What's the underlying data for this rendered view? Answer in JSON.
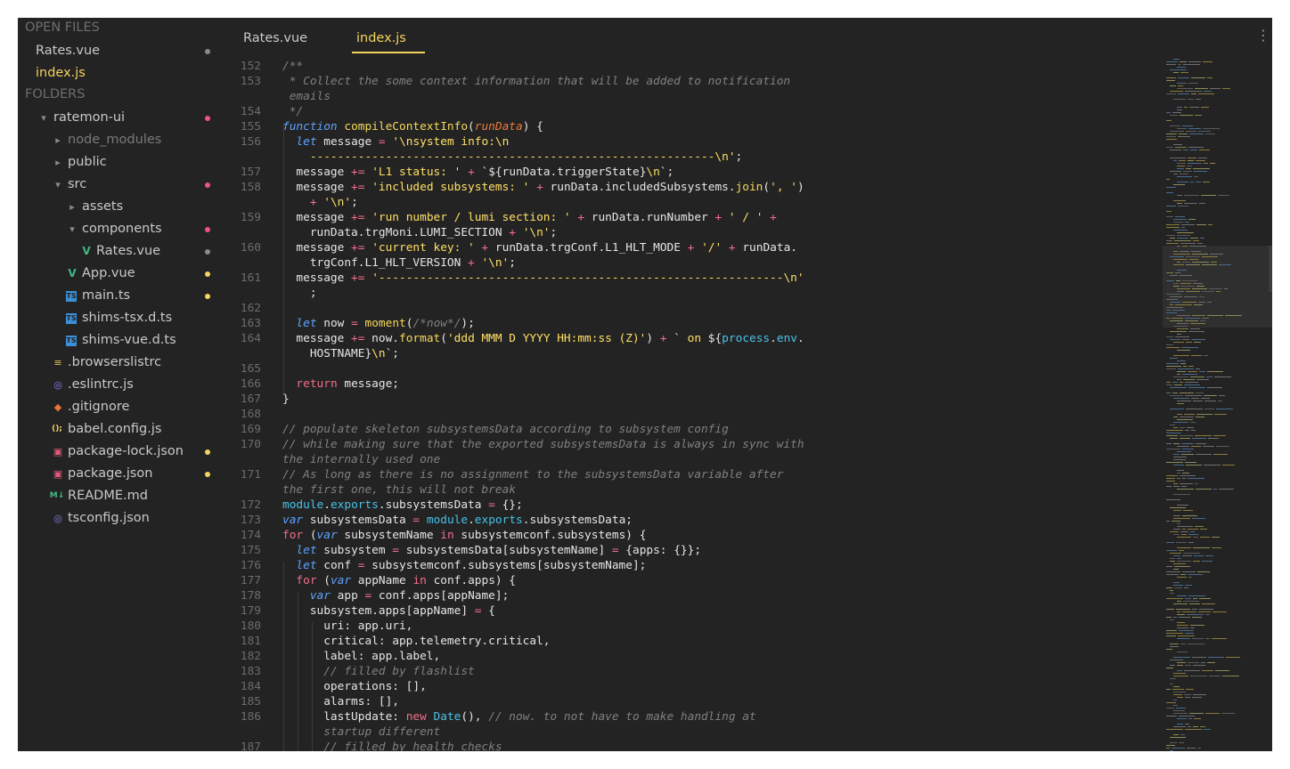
{
  "sidebar": {
    "open_files_label": "OPEN FILES",
    "folders_label": "FOLDERS",
    "open_files": [
      {
        "label": "Rates.vue",
        "active": false,
        "dot": "#8a8a8a"
      },
      {
        "label": "index.js",
        "active": true,
        "dot": ""
      }
    ],
    "tree": [
      {
        "label": "ratemon-ui",
        "indent": 0,
        "icon": "chevron-down-icon",
        "glyph": "▾",
        "icon_color": "#8a8a8a",
        "dot": "#f0508c",
        "muted": false
      },
      {
        "label": "node_modules",
        "indent": 1,
        "icon": "chevron-right-icon",
        "glyph": "▸",
        "icon_color": "#8a8a8a",
        "dot": "",
        "muted": true
      },
      {
        "label": "public",
        "indent": 1,
        "icon": "chevron-right-icon",
        "glyph": "▸",
        "icon_color": "#8a8a8a",
        "dot": "",
        "muted": false
      },
      {
        "label": "src",
        "indent": 1,
        "icon": "chevron-down-icon",
        "glyph": "▾",
        "icon_color": "#8a8a8a",
        "dot": "#f0508c",
        "muted": false
      },
      {
        "label": "assets",
        "indent": 2,
        "icon": "chevron-right-icon",
        "glyph": "▸",
        "icon_color": "#8a8a8a",
        "dot": "",
        "muted": false
      },
      {
        "label": "components",
        "indent": 2,
        "icon": "chevron-down-icon",
        "glyph": "▾",
        "icon_color": "#8a8a8a",
        "dot": "#f0508c",
        "muted": false
      },
      {
        "label": "Rates.vue",
        "indent": 3,
        "icon": "vue-file-icon",
        "glyph": "V",
        "icon_color": "#41b883",
        "dot": "#8a8a8a",
        "muted": false
      },
      {
        "label": "App.vue",
        "indent": 2,
        "icon": "vue-file-icon",
        "glyph": "V",
        "icon_color": "#41b883",
        "dot": "#f4d35e",
        "muted": false
      },
      {
        "label": "main.ts",
        "indent": 2,
        "icon": "typescript-file-icon",
        "glyph": "TS",
        "icon_color": "#3a8fd6",
        "dot": "#f4d35e",
        "muted": false
      },
      {
        "label": "shims-tsx.d.ts",
        "indent": 2,
        "icon": "typescript-file-icon",
        "glyph": "TS",
        "icon_color": "#3a8fd6",
        "dot": "",
        "muted": false
      },
      {
        "label": "shims-vue.d.ts",
        "indent": 2,
        "icon": "typescript-file-icon",
        "glyph": "TS",
        "icon_color": "#3a8fd6",
        "dot": "",
        "muted": false
      },
      {
        "label": ".browserslistrc",
        "indent": 1,
        "icon": "list-file-icon",
        "glyph": "≡",
        "icon_color": "#e0c25a",
        "dot": "",
        "muted": false
      },
      {
        "label": ".eslintrc.js",
        "indent": 1,
        "icon": "eslint-file-icon",
        "glyph": "◎",
        "icon_color": "#8b7fe8",
        "dot": "",
        "muted": false
      },
      {
        "label": ".gitignore",
        "indent": 1,
        "icon": "git-file-icon",
        "glyph": "◆",
        "icon_color": "#e8743b",
        "dot": "",
        "muted": false
      },
      {
        "label": "babel.config.js",
        "indent": 1,
        "icon": "js-config-file-icon",
        "glyph": "();",
        "icon_color": "#f4d35e",
        "dot": "",
        "muted": false
      },
      {
        "label": "package-lock.json",
        "indent": 1,
        "icon": "npm-file-icon",
        "glyph": "▣",
        "icon_color": "#e05a7a",
        "dot": "#f4d35e",
        "muted": false
      },
      {
        "label": "package.json",
        "indent": 1,
        "icon": "npm-file-icon",
        "glyph": "▣",
        "icon_color": "#e05a7a",
        "dot": "#f4d35e",
        "muted": false
      },
      {
        "label": "README.md",
        "indent": 1,
        "icon": "markdown-file-icon",
        "glyph": "M↓",
        "icon_color": "#41b883",
        "dot": "",
        "muted": false
      },
      {
        "label": "tsconfig.json",
        "indent": 1,
        "icon": "tsconfig-file-icon",
        "glyph": "◎",
        "icon_color": "#7f86d9",
        "dot": "",
        "muted": false
      }
    ]
  },
  "tabs": [
    {
      "label": "Rates.vue",
      "active": false
    },
    {
      "label": "index.js",
      "active": true
    }
  ],
  "editor": {
    "line_numbers": [
      {
        "n": "152",
        "row": 0
      },
      {
        "n": "153",
        "row": 1
      },
      {
        "n": "154",
        "row": 3
      },
      {
        "n": "155",
        "row": 4
      },
      {
        "n": "156",
        "row": 5
      },
      {
        "n": "157",
        "row": 7
      },
      {
        "n": "158",
        "row": 8
      },
      {
        "n": "159",
        "row": 10
      },
      {
        "n": "160",
        "row": 12
      },
      {
        "n": "161",
        "row": 14
      },
      {
        "n": "162",
        "row": 16
      },
      {
        "n": "163",
        "row": 17
      },
      {
        "n": "164",
        "row": 18
      },
      {
        "n": "165",
        "row": 20
      },
      {
        "n": "166",
        "row": 21
      },
      {
        "n": "167",
        "row": 22
      },
      {
        "n": "168",
        "row": 23
      },
      {
        "n": "169",
        "row": 24
      },
      {
        "n": "170",
        "row": 25
      },
      {
        "n": "171",
        "row": 27
      },
      {
        "n": "172",
        "row": 29
      },
      {
        "n": "173",
        "row": 30
      },
      {
        "n": "174",
        "row": 31
      },
      {
        "n": "175",
        "row": 32
      },
      {
        "n": "176",
        "row": 33
      },
      {
        "n": "177",
        "row": 34
      },
      {
        "n": "178",
        "row": 35
      },
      {
        "n": "179",
        "row": 36
      },
      {
        "n": "180",
        "row": 37
      },
      {
        "n": "181",
        "row": 38
      },
      {
        "n": "182",
        "row": 39
      },
      {
        "n": "183",
        "row": 40
      },
      {
        "n": "184",
        "row": 41
      },
      {
        "n": "185",
        "row": 42
      },
      {
        "n": "186",
        "row": 43
      },
      {
        "n": "187",
        "row": 45
      }
    ],
    "code_lines": [
      [
        [
          "c",
          "/**"
        ]
      ],
      [
        [
          "c",
          " * Collect the some context information that will be added to notification"
        ]
      ],
      [
        [
          "c",
          " emails"
        ]
      ],
      [
        [
          "c",
          " */"
        ]
      ],
      [
        [
          "ki",
          "function"
        ],
        [
          "",
          " "
        ],
        [
          "f",
          "compileContextInfo"
        ],
        [
          "",
          "("
        ],
        [
          "p",
          "runData"
        ],
        [
          "",
          ") {"
        ]
      ],
      [
        [
          "",
          "  "
        ],
        [
          "ki",
          "let"
        ],
        [
          "",
          " message "
        ],
        [
          "o",
          "="
        ],
        [
          "",
          " "
        ],
        [
          "s",
          "'\\nsystem info:\\n"
        ]
      ],
      [
        [
          "s",
          "    -----------------------------------------------------------\\n'"
        ],
        [
          "",
          ";"
        ]
      ],
      [
        [
          "",
          "  message "
        ],
        [
          "o",
          "+="
        ],
        [
          "",
          " "
        ],
        [
          "s",
          "'L1 status: '"
        ],
        [
          "",
          " "
        ],
        [
          "o",
          "+"
        ],
        [
          "",
          " `${runData.triggerState}"
        ],
        [
          "s",
          "\\n"
        ],
        [
          "",
          "`;"
        ]
      ],
      [
        [
          "",
          "  message "
        ],
        [
          "o",
          "+="
        ],
        [
          "",
          " "
        ],
        [
          "s",
          "'included subsystems: '"
        ],
        [
          "",
          " "
        ],
        [
          "o",
          "+"
        ],
        [
          "",
          " runData.includedSubsystems."
        ],
        [
          "f",
          "join"
        ],
        [
          "",
          "("
        ],
        [
          "s",
          "', '"
        ],
        [
          "",
          ")"
        ]
      ],
      [
        [
          "",
          "    "
        ],
        [
          "o",
          "+"
        ],
        [
          "",
          " "
        ],
        [
          "s",
          "'\\n'"
        ],
        [
          "",
          ";"
        ]
      ],
      [
        [
          "",
          "  message "
        ],
        [
          "o",
          "+="
        ],
        [
          "",
          " "
        ],
        [
          "s",
          "'run number / lumi section: '"
        ],
        [
          "",
          " "
        ],
        [
          "o",
          "+"
        ],
        [
          "",
          " runData.runNumber "
        ],
        [
          "o",
          "+"
        ],
        [
          "",
          " "
        ],
        [
          "s",
          "' / '"
        ],
        [
          "",
          " "
        ],
        [
          "o",
          "+"
        ]
      ],
      [
        [
          "",
          "    runData.trgMoni.LUMI_SECTION "
        ],
        [
          "o",
          "+"
        ],
        [
          "",
          " "
        ],
        [
          "s",
          "'\\n'"
        ],
        [
          "",
          ";"
        ]
      ],
      [
        [
          "",
          "  message "
        ],
        [
          "o",
          "+="
        ],
        [
          "",
          " "
        ],
        [
          "s",
          "'current key: '"
        ],
        [
          "",
          " "
        ],
        [
          "o",
          "+"
        ],
        [
          "",
          " runData.trgConf.L1_HLT_MODE "
        ],
        [
          "o",
          "+"
        ],
        [
          "",
          " "
        ],
        [
          "s",
          "'/'"
        ],
        [
          "",
          " "
        ],
        [
          "o",
          "+"
        ],
        [
          "",
          " runData."
        ]
      ],
      [
        [
          "",
          "    trgConf.L1_HLT_VERSION "
        ],
        [
          "o",
          "+"
        ],
        [
          "",
          " "
        ],
        [
          "s",
          "'\\n'"
        ],
        [
          "",
          ";"
        ]
      ],
      [
        [
          "",
          "  message "
        ],
        [
          "o",
          "+="
        ],
        [
          "",
          " "
        ],
        [
          "s",
          "'-----------------------------------------------------------\\n'"
        ]
      ],
      [
        [
          "",
          "    ;"
        ]
      ],
      [
        [
          "",
          ""
        ]
      ],
      [
        [
          "",
          "  "
        ],
        [
          "ki",
          "let"
        ],
        [
          "",
          " now "
        ],
        [
          "o",
          "="
        ],
        [
          "",
          " "
        ],
        [
          "f",
          "moment"
        ],
        [
          "",
          "("
        ],
        [
          "c",
          "/*now*/"
        ],
        [
          "",
          ");"
        ]
      ],
      [
        [
          "",
          "  message "
        ],
        [
          "o",
          "+="
        ],
        [
          "",
          " now."
        ],
        [
          "f",
          "format"
        ],
        [
          "",
          "("
        ],
        [
          "s",
          "'ddd MMM D YYYY HH:mm:ss (Z)'"
        ],
        [
          "",
          ") "
        ],
        [
          "o",
          "+"
        ],
        [
          "",
          " ` "
        ],
        [
          "s",
          "on"
        ],
        [
          "",
          " ${"
        ],
        [
          "t",
          "process"
        ],
        [
          "",
          "."
        ],
        [
          "t",
          "env"
        ],
        [
          "",
          "."
        ]
      ],
      [
        [
          "",
          "    HOSTNAME}"
        ],
        [
          "s",
          "\\n"
        ],
        [
          "",
          "`;"
        ]
      ],
      [
        [
          "",
          ""
        ]
      ],
      [
        [
          "",
          "  "
        ],
        [
          "r",
          "return"
        ],
        [
          "",
          " message;"
        ]
      ],
      [
        [
          "",
          "}"
        ]
      ],
      [
        [
          "",
          ""
        ]
      ],
      [
        [
          "c",
          "// populate skeleton subsystemsData according to subsystem config"
        ]
      ],
      [
        [
          "c",
          "// while making sure that the exported subsystemsData is always in sync with"
        ]
      ],
      [
        [
          "c",
          "the internally used one"
        ]
      ],
      [
        [
          "c",
          "// As long as there is no assignment to the subsystemsData variable after"
        ]
      ],
      [
        [
          "c",
          "the first one, this will not break"
        ]
      ],
      [
        [
          "t",
          "module"
        ],
        [
          "",
          "."
        ],
        [
          "t",
          "exports"
        ],
        [
          "",
          ".subsystemsData "
        ],
        [
          "o",
          "="
        ],
        [
          "",
          " {};"
        ]
      ],
      [
        [
          "ki",
          "var"
        ],
        [
          "",
          " subsystemsData "
        ],
        [
          "o",
          "="
        ],
        [
          "",
          " "
        ],
        [
          "t",
          "module"
        ],
        [
          "",
          "."
        ],
        [
          "t",
          "exports"
        ],
        [
          "",
          ".subsystemsData;"
        ]
      ],
      [
        [
          "r",
          "for"
        ],
        [
          "",
          " ("
        ],
        [
          "ki",
          "var"
        ],
        [
          "",
          " subsystemName "
        ],
        [
          "r",
          "in"
        ],
        [
          "",
          " subsystemconf.subsystems) {"
        ]
      ],
      [
        [
          "",
          "  "
        ],
        [
          "ki",
          "let"
        ],
        [
          "",
          " subsystem "
        ],
        [
          "o",
          "="
        ],
        [
          "",
          " subsystemsData[subsystemName] "
        ],
        [
          "o",
          "="
        ],
        [
          "",
          " {apps: {}};"
        ]
      ],
      [
        [
          "",
          "  "
        ],
        [
          "ki",
          "let"
        ],
        [
          "",
          " conf "
        ],
        [
          "o",
          "="
        ],
        [
          "",
          " subsystemconf.subsystems[subsystemName];"
        ]
      ],
      [
        [
          "",
          "  "
        ],
        [
          "r",
          "for"
        ],
        [
          "",
          " ("
        ],
        [
          "ki",
          "var"
        ],
        [
          "",
          " appName "
        ],
        [
          "r",
          "in"
        ],
        [
          "",
          " conf.apps) {"
        ]
      ],
      [
        [
          "",
          "    "
        ],
        [
          "ki",
          "var"
        ],
        [
          "",
          " app "
        ],
        [
          "o",
          "="
        ],
        [
          "",
          " conf.apps[appName];"
        ]
      ],
      [
        [
          "",
          "    subsystem.apps[appName] "
        ],
        [
          "o",
          "="
        ],
        [
          "",
          " {"
        ]
      ],
      [
        [
          "",
          "      uri: app.uri,"
        ]
      ],
      [
        [
          "",
          "      critical: app.telemetry.critical,"
        ]
      ],
      [
        [
          "",
          "      label: app.label,"
        ]
      ],
      [
        [
          "",
          "      "
        ],
        [
          "c",
          "// filled by flashlist"
        ]
      ],
      [
        [
          "",
          "      operations: [],"
        ]
      ],
      [
        [
          "",
          "      alarms: [],"
        ]
      ],
      [
        [
          "",
          "      lastUpdate: "
        ],
        [
          "r",
          "new"
        ],
        [
          "",
          " "
        ],
        [
          "t",
          "Date"
        ],
        [
          "",
          "(), "
        ],
        [
          "c",
          "// now. to not have to make handling at"
        ]
      ],
      [
        [
          "",
          "      "
        ],
        [
          "c",
          "startup different"
        ]
      ],
      [
        [
          "",
          "      "
        ],
        [
          "c",
          "// filled by health checks"
        ]
      ]
    ]
  },
  "more_icon": "more-vertical-icon",
  "colors": {
    "background": "#232323",
    "accent": "#f4d35e",
    "modified_dot_pink": "#f0508c",
    "modified_dot_yellow": "#f4d35e"
  }
}
